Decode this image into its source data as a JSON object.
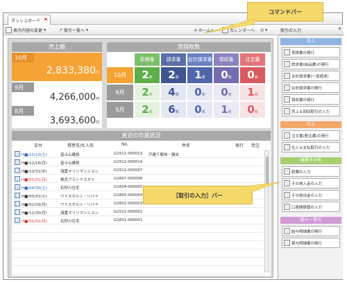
{
  "window": {
    "tab_title": "ダッシュボード"
  },
  "toolbar": {
    "change_display": "表示内容の変更",
    "deal_list": "取引一覧へ",
    "home": "ホームへ",
    "calendar": "カレンダーへ"
  },
  "callouts": {
    "command_bar": "コマンドバー",
    "input_bar": "［取引の入力］バー"
  },
  "sales": {
    "title": "売上額",
    "months": [
      {
        "label": "10月",
        "amount": "2,833,380",
        "unit": "円"
      },
      {
        "label": "9月",
        "amount": "4,266,000",
        "unit": "円"
      },
      {
        "label": "8月",
        "amount": "3,693,600",
        "unit": "円"
      }
    ]
  },
  "registered": {
    "title": "登録枚数",
    "columns": [
      "見積書",
      "請求書",
      "合計請求書",
      "領収書",
      "注文書"
    ],
    "rows": [
      {
        "month": "10月",
        "values": [
          "2",
          "2",
          "1",
          "0",
          "0"
        ]
      },
      {
        "month": "9月",
        "values": [
          "2",
          "4",
          "0",
          "0",
          "1"
        ]
      },
      {
        "month": "8月",
        "values": [
          "2",
          "6",
          "0",
          "1",
          "0"
        ]
      }
    ],
    "unit": "枚"
  },
  "recent": {
    "title": "直近の作業状況",
    "headers": [
      "日付",
      "得意先/仕入先",
      "No.",
      "件名",
      "発行",
      "受注"
    ],
    "rows": [
      {
        "date": "H■/11/10(土)",
        "client": "富士山建設",
        "no": "G1511-000013",
        "subject": "戸建て解体・撤去"
      },
      {
        "date": "H■/12/18(月)",
        "client": "富士山建設",
        "no": "G1512-000014",
        "subject": ""
      },
      {
        "date": "H■/12/31(水)",
        "client": "湯雲マリンマンション",
        "no": "G1512-000007",
        "subject": ""
      },
      {
        "date": "H■/01/31(日)",
        "client": "株式ブランドスカイ",
        "no": "G1607-000006",
        "subject": ""
      },
      {
        "date": "H■/04/30(土)",
        "client": "石狩川住宅",
        "no": "G1604-000005",
        "subject": ""
      },
      {
        "date": "H■/05/31(火)",
        "client": "ワイスホルン・リバイ",
        "no": "G1605-000004",
        "subject": ""
      },
      {
        "date": "H■/02/29(月)",
        "client": "ワイスホルン・リバイ",
        "no": "G1602-000003",
        "subject": ""
      },
      {
        "date": "H■/11/30(月)",
        "client": "湯雲マリンマンション",
        "no": "G1511-000002",
        "subject": ""
      },
      {
        "date": "H■/01/31(日)",
        "client": "石狩川住宅",
        "no": "G1601-000001",
        "subject": ""
      },
      {
        "date": "",
        "client": "",
        "no": "",
        "subject": ""
      },
      {
        "date": "",
        "client": "",
        "no": "",
        "subject": ""
      },
      {
        "date": "",
        "client": "",
        "no": "",
        "subject": ""
      },
      {
        "date": "",
        "client": "",
        "no": "",
        "subject": ""
      },
      {
        "date": "",
        "client": "",
        "no": "",
        "subject": ""
      },
      {
        "date": "",
        "client": "",
        "no": "",
        "subject": ""
      }
    ]
  },
  "side": {
    "title": "取引の入力",
    "sections": [
      {
        "title": "売上",
        "color": "#8fb4e3",
        "items": [
          "見積書の発行",
          "請求書(納品書)の発行",
          "合計請求書(一括請求)",
          "合計請求書の発行",
          "領収書の発行",
          "売上＆回収取引の入力"
        ]
      },
      {
        "title": "仕入",
        "color": "#f3a86a",
        "items": [
          "注文書(発注書)の発行",
          "仕入＆支払取引の入力"
        ]
      },
      {
        "title": "経費その他",
        "color": "#a6cf6f",
        "items": [
          "経費の入力",
          "その他入金の入力",
          "その他出金の入力",
          "口座間振替の入力"
        ]
      },
      {
        "title": "給与・賞与",
        "color": "#d19bd6",
        "items": [
          "給与明細書の発行",
          "賞与明細書の発行"
        ]
      }
    ]
  }
}
